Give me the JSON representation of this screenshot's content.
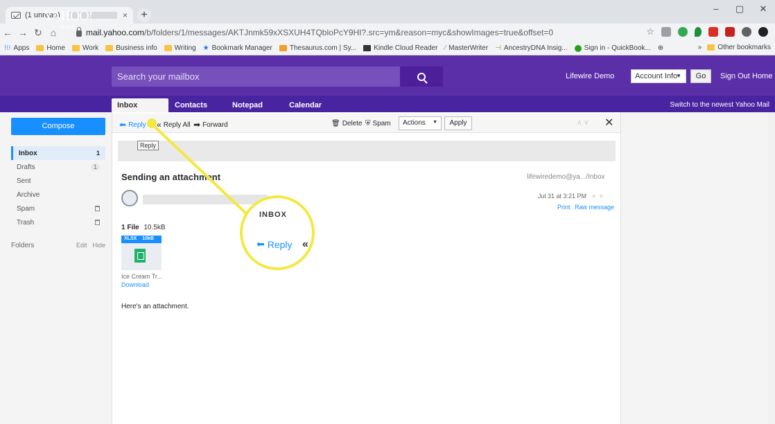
{
  "browser": {
    "tab_title": "(1 unread) -",
    "tab_close": "×",
    "new_tab": "+",
    "url_host": "mail.yahoo.com",
    "url_path": "/b/folders/1/messages/AKTJnmk59xXSXUH4TQbloPcY9HI?.src=ym&reason=myc&showImages=true&offset=0",
    "window_controls": [
      "–",
      "▢",
      "✕"
    ],
    "bookmarks": [
      "Apps",
      "Home",
      "Work",
      "Business info",
      "Writing",
      "Bookmark Manager",
      "Thesaurus.com | Sy...",
      "Kindle Cloud Reader",
      "MasterWriter",
      "AncestryDNA Insig...",
      "Sign in - QuickBook..."
    ],
    "overflow": "»",
    "other_bookmarks": "Other bookmarks"
  },
  "header": {
    "logo": "YAHOO!",
    "logo_sub": "MAIL",
    "search_placeholder": "Search your mailbox",
    "user_name": "Lifewire Demo",
    "account_select": "Account Info",
    "go": "Go",
    "sign_out": "Sign Out",
    "home": "Home"
  },
  "nav": {
    "tabs": [
      "Inbox",
      "Contacts",
      "Notepad",
      "Calendar"
    ],
    "switch_link": "Switch to the newest Yahoo Mail"
  },
  "sidebar": {
    "compose": "Compose",
    "folders": [
      {
        "label": "Inbox",
        "count": "1"
      },
      {
        "label": "Drafts",
        "count": "1"
      },
      {
        "label": "Sent",
        "count": ""
      },
      {
        "label": "Archive",
        "count": ""
      },
      {
        "label": "Spam",
        "count": ""
      },
      {
        "label": "Trash",
        "count": ""
      }
    ],
    "folders_header": "Folders",
    "edit": "Edit",
    "hide": "Hide"
  },
  "toolbar": {
    "reply": "Reply",
    "reply_all": "Reply All",
    "forward": "Forward",
    "delete": "Delete",
    "spam": "Spam",
    "actions": "Actions",
    "apply": "Apply",
    "tooltip": "Reply"
  },
  "message": {
    "subject": "Sending an attachment",
    "folder_path": "lifewiredemo@ya.../Inbox",
    "date": "Jul 31 at 3:21 PM",
    "print": "Print",
    "raw": "Raw message",
    "files_label": "1 File",
    "files_size": "10.5kB",
    "att_type": "XLSX",
    "att_size": "10kB",
    "att_name": "Ice Cream Tr...",
    "download": "Download",
    "body": "Here's an attachment."
  },
  "magnifier": {
    "inbox_text": "INBOX",
    "reply_text": "Reply"
  },
  "colors": {
    "brand_purple": "#5b2fa8",
    "accent_blue": "#188fff",
    "highlight_yellow": "#f4e842"
  }
}
